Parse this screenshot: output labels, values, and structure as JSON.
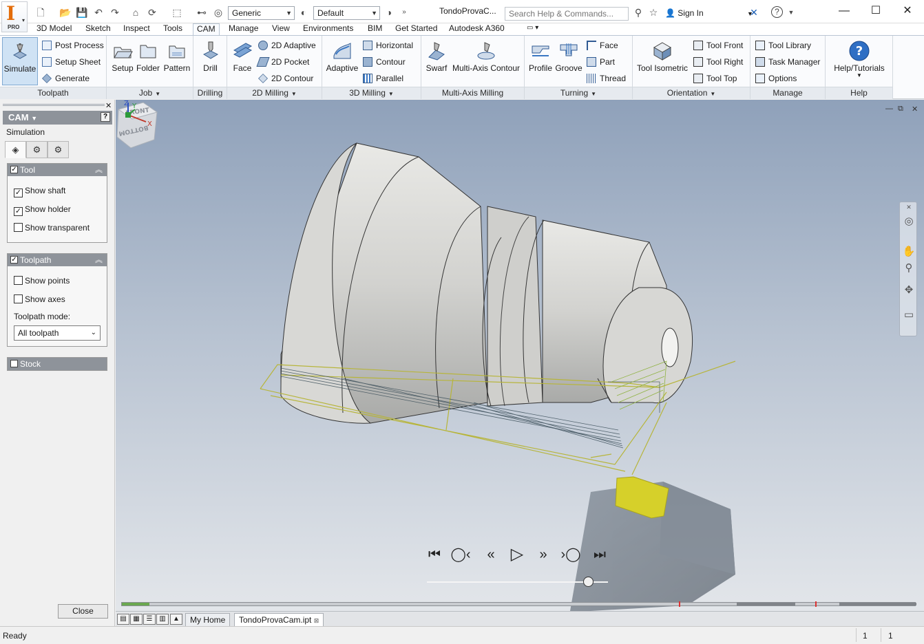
{
  "app": {
    "logo_text": "I",
    "logo_edition": "PRO",
    "doc_title": "TondoProvaC...",
    "search_placeholder": "Search Help & Commands...",
    "sign_in": "Sign In",
    "style_select": "Generic",
    "appearance_select": "Default"
  },
  "menu": {
    "tabs": [
      "3D Model",
      "Sketch",
      "Inspect",
      "Tools",
      "CAM",
      "Manage",
      "View",
      "Environments",
      "BIM",
      "Get Started",
      "Autodesk A360"
    ],
    "active": "CAM"
  },
  "ribbon": {
    "toolpath": {
      "title": "Toolpath",
      "simulate": "Simulate",
      "post_process": "Post Process",
      "setup_sheet": "Setup Sheet",
      "generate": "Generate"
    },
    "job": {
      "title": "Job",
      "setup": "Setup",
      "folder": "Folder",
      "pattern": "Pattern"
    },
    "drilling": {
      "title": "Drilling",
      "drill": "Drill"
    },
    "milling2d": {
      "title": "2D Milling",
      "face": "Face",
      "adaptive": "2D Adaptive",
      "pocket": "2D Pocket",
      "contour": "2D Contour"
    },
    "milling3d": {
      "title": "3D Milling",
      "adaptive": "Adaptive",
      "horizontal": "Horizontal",
      "contour": "Contour",
      "parallel": "Parallel"
    },
    "multiaxis": {
      "title": "Multi-Axis Milling",
      "swarf": "Swarf",
      "contour": "Multi-Axis Contour"
    },
    "turning": {
      "title": "Turning",
      "profile": "Profile",
      "groove": "Groove",
      "face": "Face",
      "part": "Part",
      "thread": "Thread"
    },
    "orientation": {
      "title": "Orientation",
      "isometric": "Tool Isometric",
      "front": "Tool Front",
      "right": "Tool Right",
      "top": "Tool Top"
    },
    "manage": {
      "title": "Manage",
      "library": "Tool Library",
      "task_manager": "Task Manager",
      "options": "Options"
    },
    "help": {
      "title": "Help",
      "tutorials": "Help/Tutorials"
    }
  },
  "browser": {
    "header": "CAM",
    "section": "Simulation",
    "tool_group": {
      "title": "Tool",
      "show_shaft": "Show shaft",
      "show_shaft_checked": true,
      "show_holder": "Show holder",
      "show_holder_checked": true,
      "show_transparent": "Show transparent",
      "show_transparent_checked": false
    },
    "toolpath_group": {
      "title": "Toolpath",
      "show_points": "Show points",
      "show_axes": "Show axes",
      "mode_label": "Toolpath mode:",
      "mode_value": "All toolpath"
    },
    "stock_group": {
      "title": "Stock"
    },
    "close": "Close"
  },
  "viewcube": {
    "front": "FRONT",
    "bottom": "BOTTOM"
  },
  "triad": {
    "x": "X",
    "y": "Y",
    "z": "Z"
  },
  "simulation": {
    "slider_position": 0.89,
    "timeline_progress": 0.035
  },
  "doc_tabs": {
    "home": "My Home",
    "active": "TondoProvaCam.ipt"
  },
  "status": {
    "text": "Ready",
    "num1": "1",
    "num2": "1"
  },
  "colors": {
    "accent": "#e36c0a",
    "toolpath": "#c9c832",
    "insert": "#d6d02a",
    "viewport_top": "#8fa1ba"
  }
}
